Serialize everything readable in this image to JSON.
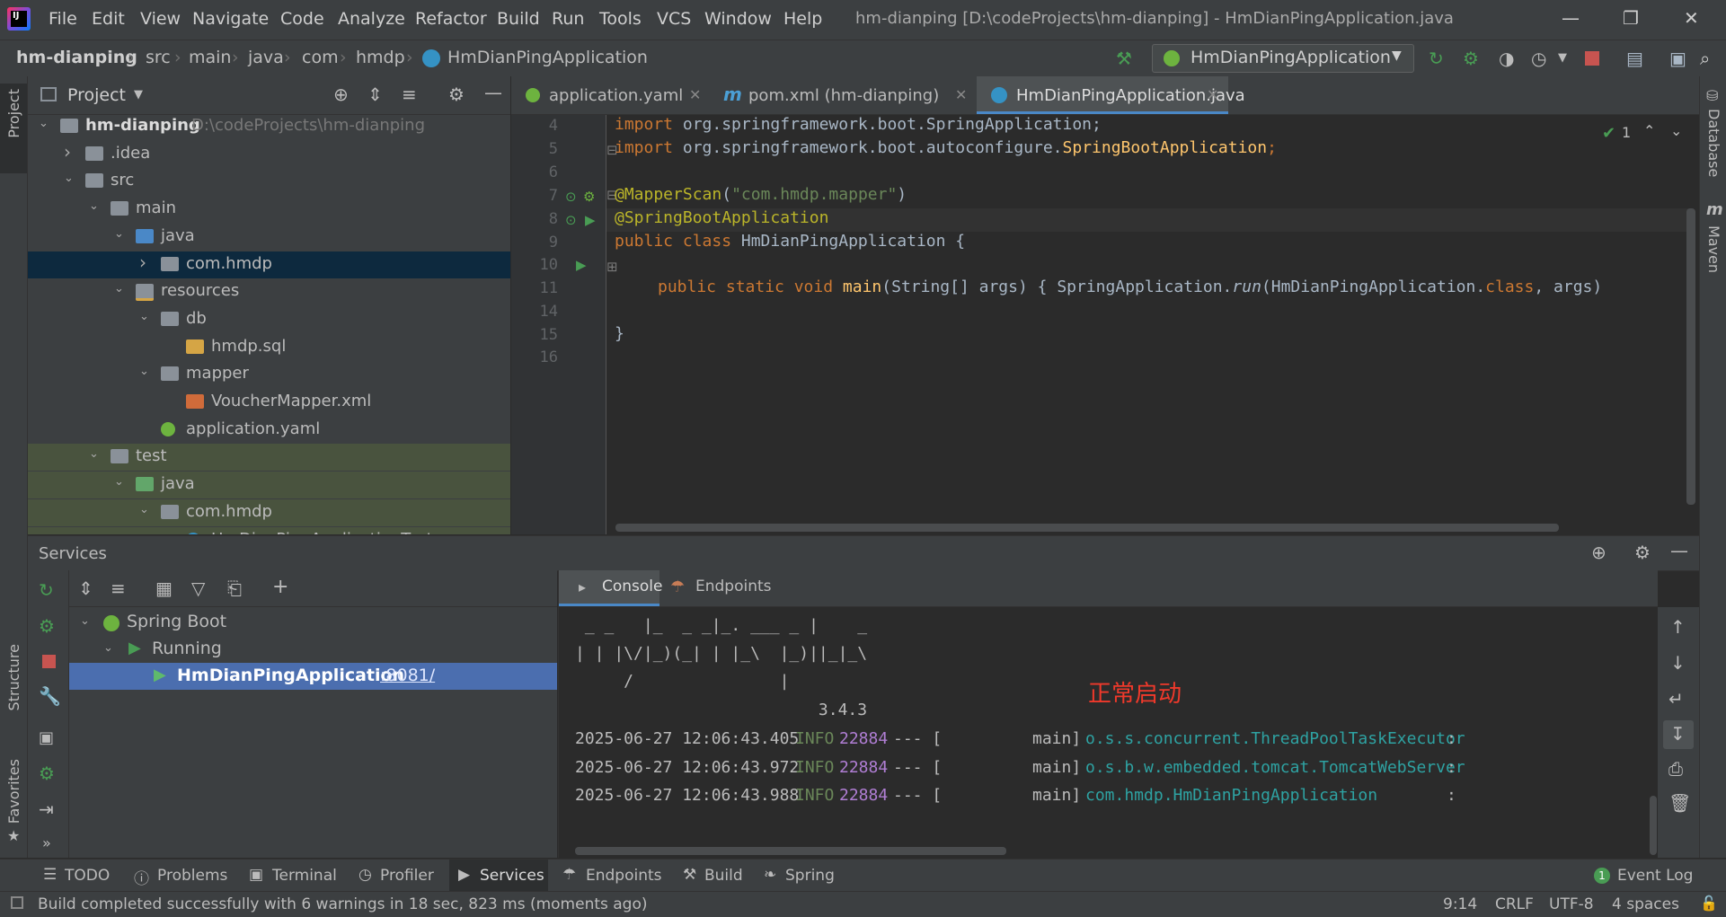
{
  "titlebar": {
    "menus": [
      "File",
      "Edit",
      "View",
      "Navigate",
      "Code",
      "Analyze",
      "Refactor",
      "Build",
      "Run",
      "Tools",
      "VCS",
      "Window",
      "Help"
    ],
    "window_title": "hm-dianping [D:\\codeProjects\\hm-dianping] - HmDianPingApplication.java"
  },
  "breadcrumb": [
    "hm-dianping",
    "src",
    "main",
    "java",
    "com",
    "hmdp",
    "HmDianPingApplication"
  ],
  "run_config": "HmDianPingApplication",
  "left_stripe": {
    "project": "Project",
    "structure": "Structure",
    "favorites": "Favorites"
  },
  "right_stripe": {
    "database": "Database",
    "maven": "Maven"
  },
  "project_panel": {
    "title": "Project",
    "tree": [
      {
        "label": "hm-dianping",
        "extra": "D:\\codeProjects\\hm-dianping",
        "depth": 0,
        "arrow": "open",
        "icon": "module"
      },
      {
        "label": ".idea",
        "depth": 1,
        "arrow": "closed",
        "icon": "folder"
      },
      {
        "label": "src",
        "depth": 1,
        "arrow": "open",
        "icon": "folder"
      },
      {
        "label": "main",
        "depth": 2,
        "arrow": "open",
        "icon": "folder"
      },
      {
        "label": "java",
        "depth": 3,
        "arrow": "open",
        "icon": "folder-blue"
      },
      {
        "label": "com.hmdp",
        "depth": 4,
        "arrow": "closed",
        "icon": "package",
        "selected": true
      },
      {
        "label": "resources",
        "depth": 3,
        "arrow": "open",
        "icon": "folder-res"
      },
      {
        "label": "db",
        "depth": 4,
        "arrow": "open",
        "icon": "folder"
      },
      {
        "label": "hmdp.sql",
        "depth": 5,
        "arrow": "",
        "icon": "sql"
      },
      {
        "label": "mapper",
        "depth": 4,
        "arrow": "open",
        "icon": "folder"
      },
      {
        "label": "VoucherMapper.xml",
        "depth": 5,
        "arrow": "",
        "icon": "xml"
      },
      {
        "label": "application.yaml",
        "depth": 4,
        "arrow": "",
        "icon": "yaml"
      },
      {
        "label": "test",
        "depth": 2,
        "arrow": "open",
        "icon": "folder",
        "test": true
      },
      {
        "label": "java",
        "depth": 3,
        "arrow": "open",
        "icon": "folder-green",
        "test": true
      },
      {
        "label": "com.hmdp",
        "depth": 4,
        "arrow": "open",
        "icon": "package",
        "test": true
      },
      {
        "label": "HmDianPingApplicationTests",
        "depth": 5,
        "arrow": "",
        "icon": "class",
        "test": true
      }
    ]
  },
  "editor": {
    "tabs": [
      {
        "label": "application.yaml",
        "active": false
      },
      {
        "label": "pom.xml (hm-dianping)",
        "active": false
      },
      {
        "label": "HmDianPingApplication.java",
        "active": true
      }
    ],
    "inspection_count": "1",
    "line_numbers": [
      "4",
      "5",
      "6",
      "7",
      "8",
      "9",
      "10",
      "11",
      "14",
      "15",
      "16"
    ],
    "code": {
      "l4_kw": "import",
      "l4_rest": " org.springframework.boot.SpringApplication;",
      "l5_kw": "import",
      "l5_rest": " org.springframework.boot.autoconfigure.",
      "l5_cls": "SpringBootApplication",
      "l5_end": ";",
      "l7_ann": "@MapperScan",
      "l7_p1": "(",
      "l7_str": "\"com.hmdp.mapper\"",
      "l7_p2": ")",
      "l8_ann": "@SpringBootApplication",
      "l9_kw": "public class",
      "l9_rest": " HmDianPingApplication {",
      "l11_kw": "public static void",
      "l11_fn": " main",
      "l11_args": "(String[] args) { SpringApplication.",
      "l11_run": "run",
      "l11_tail": "(HmDianPingApplication.",
      "l11_class": "class",
      "l11_end": ", args)",
      "l15": "}"
    }
  },
  "services": {
    "title": "Services",
    "tree": [
      {
        "label": "Spring Boot"
      },
      {
        "label": "Running"
      },
      {
        "label": "HmDianPingApplication",
        "port": ":8081/"
      }
    ],
    "console_tabs": [
      "Console",
      "Endpoints"
    ],
    "console": {
      "banner1": " _ _   |_  _ _|_. ___ _ |    _",
      "banner2": "| | |\\/|_)(_| | |_\\  |_)||_|_\\",
      "banner3": "     /               |",
      "version": "                         3.4.3",
      "annotation": "正常启动",
      "logs": [
        {
          "time": "2025-06-27 12:06:43.405",
          "level": "INFO",
          "pid": "22884",
          "sep": "--- [",
          "thread": "main]",
          "logger": "o.s.s.concurrent.ThreadPoolTaskExecutor",
          "colon": ":"
        },
        {
          "time": "2025-06-27 12:06:43.972",
          "level": "INFO",
          "pid": "22884",
          "sep": "--- [",
          "thread": "main]",
          "logger": "o.s.b.w.embedded.tomcat.TomcatWebServer",
          "colon": ":"
        },
        {
          "time": "2025-06-27 12:06:43.988",
          "level": "INFO",
          "pid": "22884",
          "sep": "--- [",
          "thread": "main]",
          "logger": "com.hmdp.HmDianPingApplication",
          "colon": ":"
        }
      ]
    }
  },
  "bottom_tools": [
    "TODO",
    "Problems",
    "Terminal",
    "Profiler",
    "Services",
    "Endpoints",
    "Build",
    "Spring"
  ],
  "event_log": {
    "label": "Event Log",
    "count": "1"
  },
  "status": {
    "message": "Build completed successfully with 6 warnings in 18 sec, 823 ms (moments ago)",
    "position": "9:14",
    "line_sep": "CRLF",
    "encoding": "UTF-8",
    "indent": "4 spaces"
  },
  "colors": {
    "accent": "#4b6eaf",
    "selection": "#0d293e",
    "green": "#499c54",
    "red": "#c75450"
  }
}
